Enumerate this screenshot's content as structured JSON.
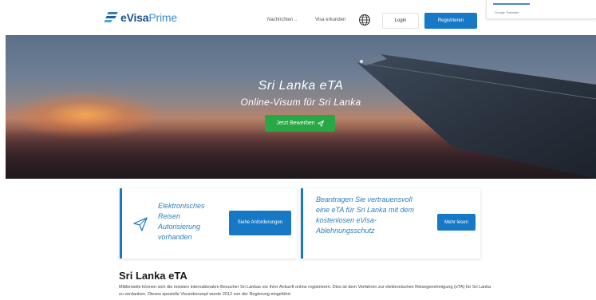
{
  "header": {
    "logo_brand": "eVisa",
    "logo_brand_light": "Prime",
    "nav": {
      "news_label": "Nachrichten",
      "explore_label": "Visa erkunden"
    },
    "language_icon": "globe-icon",
    "login_label": "Login",
    "register_label": "Registrieren"
  },
  "google_translate": {
    "label": "Google Translate"
  },
  "hero": {
    "title": "Sri Lanka eTA",
    "subtitle": "Online-Visum für Sri Lanka",
    "apply_label": "Jetzt Bewerben"
  },
  "cards": {
    "card1_text": "Elektronisches Reisen Autorisierung vorhanden",
    "card1_button": "Siehe Anforderungen",
    "card2_text": "Beantragen Sie vertrauensvoll eine eTA für Sri Lanka mit dem kostenlosen eVisa-Ablehnungsschutz",
    "card2_button": "Mehr lesen"
  },
  "content": {
    "title": "Sri Lanka eTA",
    "paragraph": "Mittlerweile können sich die meisten internationalen Besucher Sri Lankas vor ihrer Ankunft online registrieren. Dies ist dem Verfahren zur elektronischen Reisegenehmigung (eTA) für Sri Lanka zu verdanken. Dieses spezielle Visumkonzept wurde 2012 von der Regierung eingeführt."
  },
  "colors": {
    "brand_blue": "#1779c6",
    "cta_green": "#27a845",
    "card_text_blue": "#2a7fc1"
  }
}
